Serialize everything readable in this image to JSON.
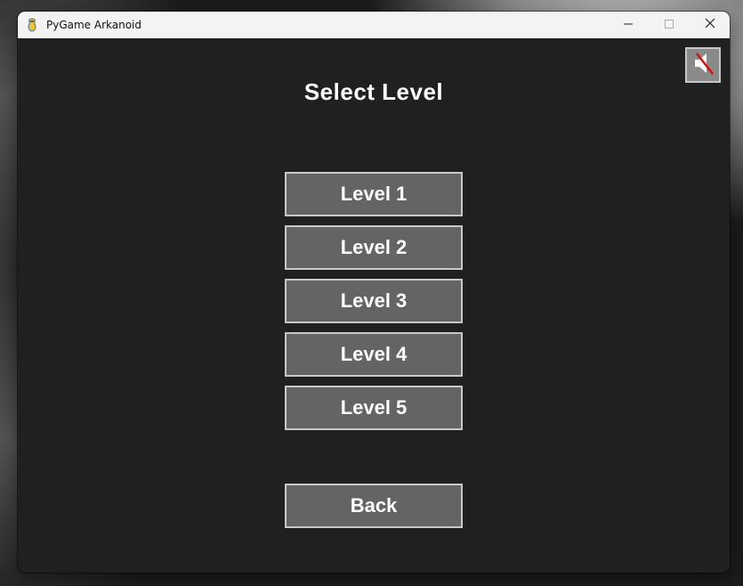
{
  "window": {
    "title": "PyGame Arkanoid",
    "app_icon": "pygame-snake-icon",
    "controls": {
      "minimize_icon": "minimize-icon",
      "maximize_icon": "maximize-icon",
      "close_icon": "close-icon"
    }
  },
  "screen": {
    "heading": "Select Level",
    "sound_toggle": {
      "icon": "speaker-muted-icon",
      "state": "muted"
    },
    "levels": [
      {
        "label": "Level 1"
      },
      {
        "label": "Level 2"
      },
      {
        "label": "Level 3"
      },
      {
        "label": "Level 4"
      },
      {
        "label": "Level 5"
      }
    ],
    "back_label": "Back"
  },
  "colors": {
    "background": "#202020",
    "button_fill": "#646464",
    "button_border": "#c8c8c8",
    "text": "#ffffff",
    "mute_slash": "#d01010"
  }
}
